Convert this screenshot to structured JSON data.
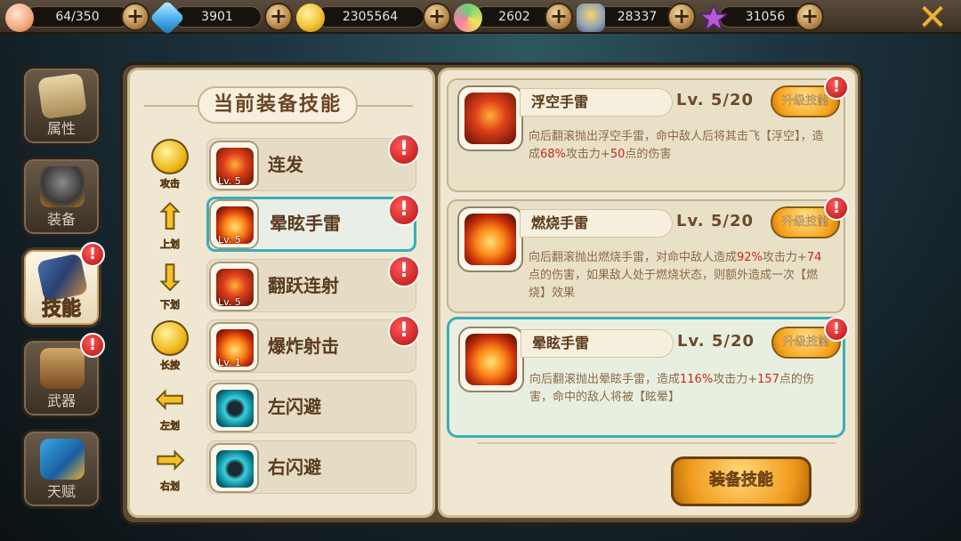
{
  "topbar": {
    "resources": [
      {
        "name": "stamina",
        "value": "64/350",
        "icon": "peach-icon",
        "color": "#f4a77c"
      },
      {
        "name": "crystal",
        "value": "3901",
        "icon": "blue-gem-icon",
        "color": "#4fb6f2"
      },
      {
        "name": "gold",
        "value": "2305564",
        "icon": "gold-coin-icon",
        "color": "#f1c232"
      },
      {
        "name": "candy",
        "value": "2602",
        "icon": "lollipop-icon",
        "color": "#6ad07a"
      },
      {
        "name": "honor",
        "value": "28337",
        "icon": "rank-badge-icon",
        "color": "#8fa0b8"
      },
      {
        "name": "star",
        "value": "31056",
        "icon": "purple-star-icon",
        "color": "#b35ad8"
      }
    ],
    "plus_label": "+",
    "close_label": "✕"
  },
  "tabs": [
    {
      "label": "属性",
      "icon": "scroll-icon"
    },
    {
      "label": "装备",
      "icon": "helmet-icon"
    },
    {
      "label": "技能",
      "icon": "skill-book-icon",
      "active": true,
      "alert": "!"
    },
    {
      "label": "武器",
      "icon": "quiver-icon",
      "alert": "!"
    },
    {
      "label": "天赋",
      "icon": "talent-arrow-icon"
    }
  ],
  "equipped": {
    "header": "当前装备技能",
    "rows": [
      {
        "control": "攻击",
        "control_icon": "tap-icon",
        "control_glyph": "",
        "name": "连发",
        "level": "Lv. 5",
        "alert": "!",
        "icon": "fire2"
      },
      {
        "control": "上划",
        "control_icon": "swipe-up-icon",
        "control_glyph": "⬆",
        "name": "晕眩手雷",
        "level": "Lv. 5",
        "alert": "!",
        "selected": true,
        "icon": "fire"
      },
      {
        "control": "下划",
        "control_icon": "swipe-down-icon",
        "control_glyph": "⬇",
        "name": "翻跃连射",
        "level": "Lv. 5",
        "alert": "!",
        "icon": "fire2"
      },
      {
        "control": "长按",
        "control_icon": "hold-icon",
        "control_glyph": "",
        "name": "爆炸射击",
        "level": "Lv. 1",
        "alert": "!",
        "icon": "fire"
      },
      {
        "control": "左划",
        "control_icon": "swipe-left-icon",
        "control_glyph": "⬅",
        "name": "左闪避",
        "level": "",
        "icon": "aqua"
      },
      {
        "control": "右划",
        "control_icon": "swipe-right-icon",
        "control_glyph": "➡",
        "name": "右闪避",
        "level": "",
        "icon": "aqua"
      }
    ]
  },
  "skills": [
    {
      "name": "浮空手雷",
      "level": "Lv. 5/20",
      "upgrade": "升级技能",
      "alert": "!",
      "icon": "fire2",
      "desc": [
        "向后翻滚抛出浮空手雷，命中敌人后将其击飞【浮空】，造成",
        "68%",
        "攻击力+",
        "50",
        "点的伤害"
      ]
    },
    {
      "name": "燃烧手雷",
      "level": "Lv. 5/20",
      "upgrade": "升级技能",
      "alert": "!",
      "icon": "fire",
      "desc": [
        "向后翻滚抛出燃烧手雷，对命中敌人造成",
        "92%",
        "攻击力+",
        "74",
        "点的伤害，如果敌人处于燃烧状态，则额外造成一次【燃烧】效果"
      ]
    },
    {
      "name": "晕眩手雷",
      "level": "Lv. 5/20",
      "upgrade": "升级技能",
      "alert": "!",
      "selected": true,
      "icon": "fire",
      "desc": [
        "向后翻滚抛出晕眩手雷，造成",
        "116%",
        "攻击力+",
        "157",
        "点的伤害，命中的敌人将被【眩晕】"
      ]
    }
  ],
  "equip_button": "装备技能"
}
